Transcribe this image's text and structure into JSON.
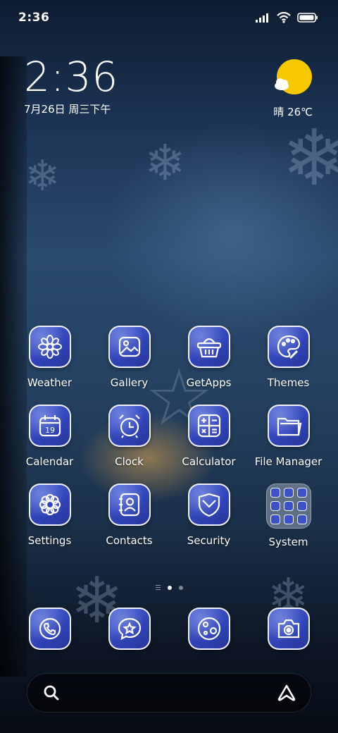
{
  "status_bar": {
    "time": "2:36",
    "icons": [
      "signal-icon",
      "wifi-icon",
      "battery-icon"
    ]
  },
  "clock_widget": {
    "time": "2:36",
    "date": "7月26日 周三下午"
  },
  "weather_widget": {
    "icon": "sunny-cloud-icon",
    "text": "晴 26℃"
  },
  "apps": [
    {
      "label": "Weather",
      "icon": "snowflake-icon"
    },
    {
      "label": "Gallery",
      "icon": "gallery-icon"
    },
    {
      "label": "GetApps",
      "icon": "basket-icon"
    },
    {
      "label": "Themes",
      "icon": "palette-icon"
    },
    {
      "label": "Calendar",
      "icon": "calendar-icon",
      "calendar_day": "19"
    },
    {
      "label": "Clock",
      "icon": "alarm-clock-icon"
    },
    {
      "label": "Calculator",
      "icon": "calculator-icon"
    },
    {
      "label": "File Manager",
      "icon": "folder-icon"
    },
    {
      "label": "Settings",
      "icon": "gear-icon"
    },
    {
      "label": "Contacts",
      "icon": "contacts-icon"
    },
    {
      "label": "Security",
      "icon": "shield-icon"
    },
    {
      "label": "System",
      "icon": "folder-grid-icon"
    }
  ],
  "page_indicator": {
    "pages": 2,
    "active_page": 1
  },
  "dock": [
    {
      "icon": "phone-icon"
    },
    {
      "icon": "message-icon"
    },
    {
      "icon": "browser-icon"
    },
    {
      "icon": "camera-icon"
    }
  ],
  "search_bar": {
    "left_icon": "search-icon",
    "right_icon": "assistant-icon"
  },
  "colors": {
    "icon_blue": "#3245b8",
    "sun_yellow": "#f5c800",
    "background_top": "#0e1c30",
    "background_bottom": "#070c15"
  }
}
